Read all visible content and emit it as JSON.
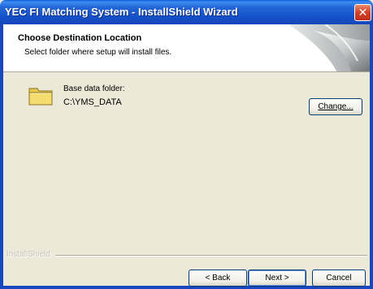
{
  "window": {
    "title": "YEC FI Matching System - InstallShield Wizard",
    "close_glyph": "✕"
  },
  "header": {
    "title": "Choose Destination Location",
    "subtitle": "Select folder where setup will install files."
  },
  "destination": {
    "label": "Base data folder:",
    "path": "C:\\YMS_DATA",
    "icon": "folder-icon"
  },
  "buttons": {
    "change": "Change...",
    "back": "< Back",
    "next": "Next >",
    "cancel": "Cancel"
  },
  "footer": {
    "brand": "InstallShield"
  }
}
